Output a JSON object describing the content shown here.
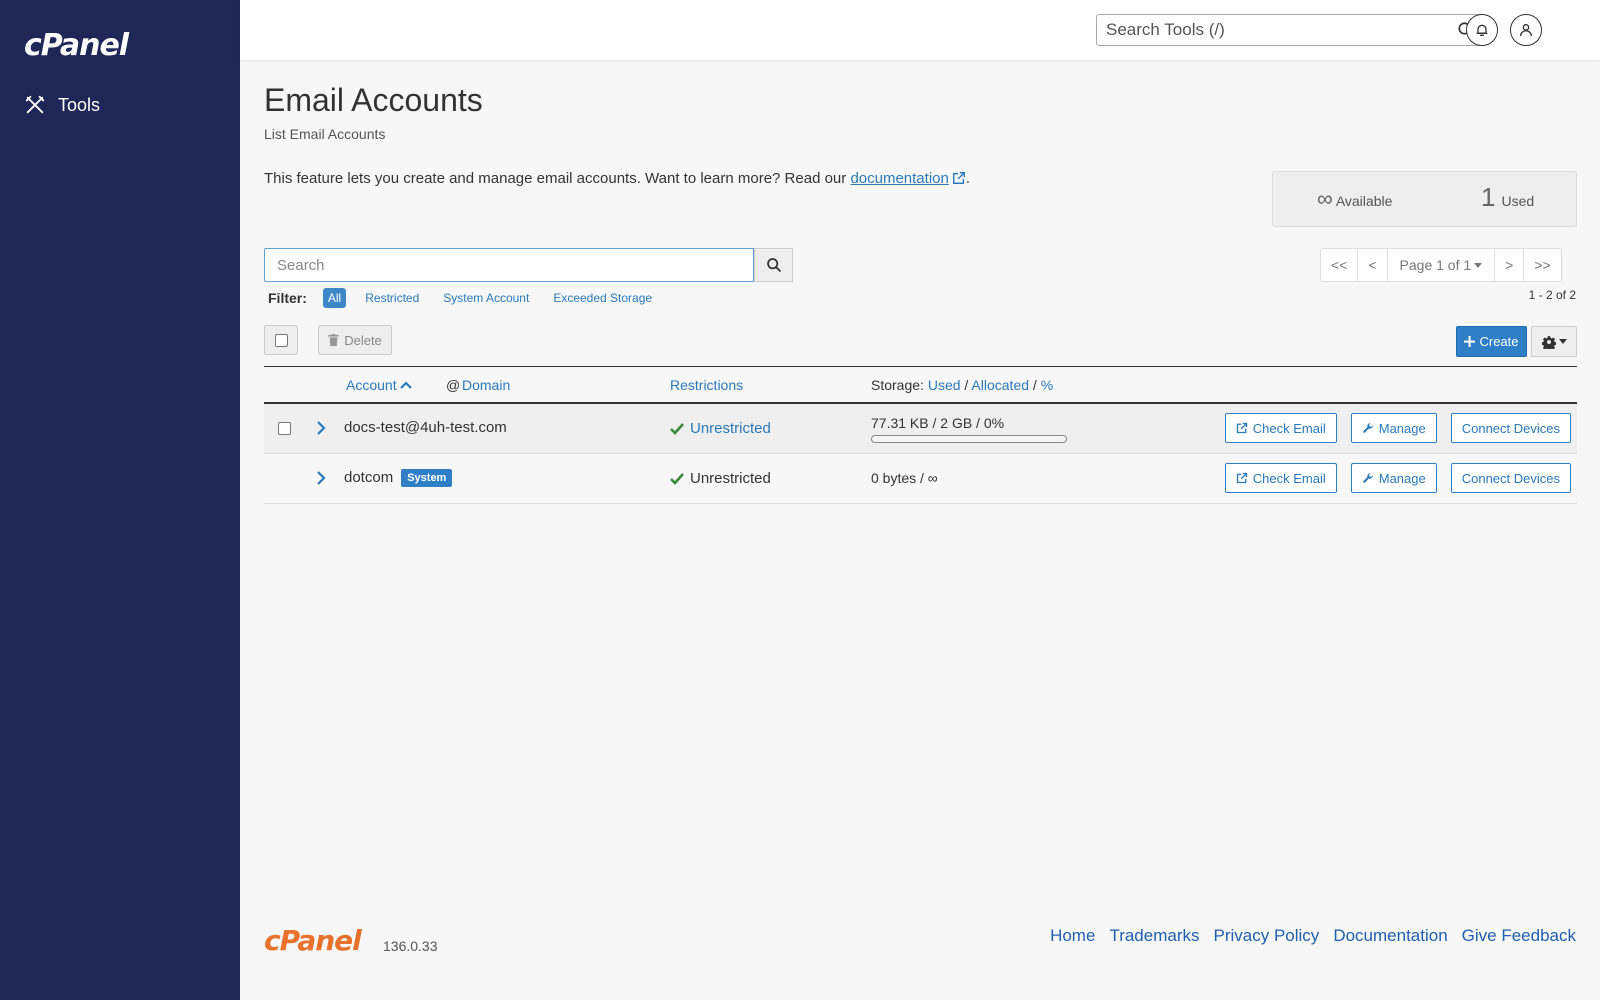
{
  "sidebar": {
    "logo_text": "cPanel",
    "nav_tools_label": "Tools"
  },
  "header": {
    "search_placeholder": "Search Tools (/)"
  },
  "page": {
    "title": "Email Accounts",
    "subtitle": "List Email Accounts",
    "intro_text": "This feature lets you create and manage email accounts. Want to learn more? Read our",
    "intro_link": "documentation",
    "intro_end": "."
  },
  "stats": {
    "available_symbol": "∞",
    "available_label": "Available",
    "used_value": "1",
    "used_label": "Used"
  },
  "search": {
    "placeholder": "Search"
  },
  "pager": {
    "first": "<<",
    "prev": "<",
    "page_label": "Page 1 of 1",
    "next": ">",
    "last": ">>",
    "range": "1 - 2 of 2"
  },
  "filter": {
    "label": "Filter:",
    "options": [
      "All",
      "Restricted",
      "System Account",
      "Exceeded Storage"
    ],
    "selected": "All"
  },
  "toolbar": {
    "delete_label": "Delete",
    "create_label": "Create"
  },
  "table": {
    "col_account": "Account",
    "col_at": "@",
    "col_domain": "Domain",
    "col_restrictions": "Restrictions",
    "col_storage_prefix": "Storage:",
    "col_used": "Used",
    "col_allocated": "Allocated",
    "col_percent": "%",
    "sep": "/",
    "rows": [
      {
        "account": "docs-test@4uh-test.com",
        "badge": "",
        "restriction": "Unrestricted",
        "storage": "77.31 KB / 2 GB / 0%",
        "usage_fraction": 0.0,
        "check_email": "Check Email",
        "manage": "Manage",
        "connect": "Connect Devices"
      },
      {
        "account": "dotcom",
        "badge": "System",
        "restriction": "Unrestricted",
        "storage": "0 bytes / ∞",
        "check_email": "Check Email",
        "manage": "Manage",
        "connect": "Connect Devices"
      }
    ]
  },
  "footer": {
    "logo_text": "cPanel",
    "version": "136.0.33",
    "links": [
      "Home",
      "Trademarks",
      "Privacy Policy",
      "Documentation",
      "Give Feedback"
    ]
  },
  "colors": {
    "sidebar_bg": "#1f2756",
    "accent": "#2f7fc6",
    "footer_logo": "#e8712c",
    "success": "#3a8a3a"
  },
  "icons": {
    "nav_tools": "tools-icon",
    "header_search": "search-icon",
    "notifications": "bell-icon",
    "user": "user-icon",
    "external_link": "external-link-icon",
    "trash": "trash-icon",
    "plus": "plus-icon",
    "gear": "gear-icon",
    "expand": "chevron-right-icon",
    "check": "check-icon",
    "wrench": "wrench-icon"
  }
}
